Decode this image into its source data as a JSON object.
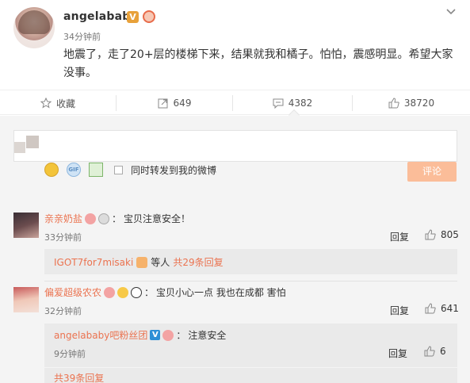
{
  "post": {
    "username": "angelababy",
    "verified_badge": "V",
    "time": "34分钟前",
    "text": "地震了，走了20+层的楼梯下来，结果就我和橘子。怕怕，震感明显。希望大家没事。"
  },
  "actions": {
    "favorite_label": "收藏",
    "forward_count": "649",
    "comment_count": "4382",
    "like_count": "38720"
  },
  "composer": {
    "forward_option_label": "同时转发到我的微博",
    "submit_label": "评论",
    "gif_label": "GIF"
  },
  "comments": [
    {
      "name": "亲亲奶盐",
      "sep": "：",
      "text": "宝贝注意安全！",
      "time": "33分钟前",
      "reply_label": "回复",
      "likes": "805",
      "sub_summary": {
        "name": "IGOT7for7misaki",
        "text": "等人",
        "count_text": "共29条回复"
      }
    },
    {
      "name": "偏爱超级农农",
      "sep": "：",
      "text": "宝贝小心一点  我也在成都  害怕",
      "time": "32分钟前",
      "reply_label": "回复",
      "likes": "641",
      "sub_reply": {
        "name": "angelababy吧粉丝团",
        "badge": "V",
        "sep": "：",
        "text": "注意安全",
        "time": "9分钟前",
        "reply_label": "回复",
        "likes": "6"
      },
      "more_text": "共39条回复"
    }
  ],
  "colors": {
    "accent": "#eb7350",
    "button_disabled": "#fbbd99",
    "panel_bg": "#f4f4f4"
  }
}
